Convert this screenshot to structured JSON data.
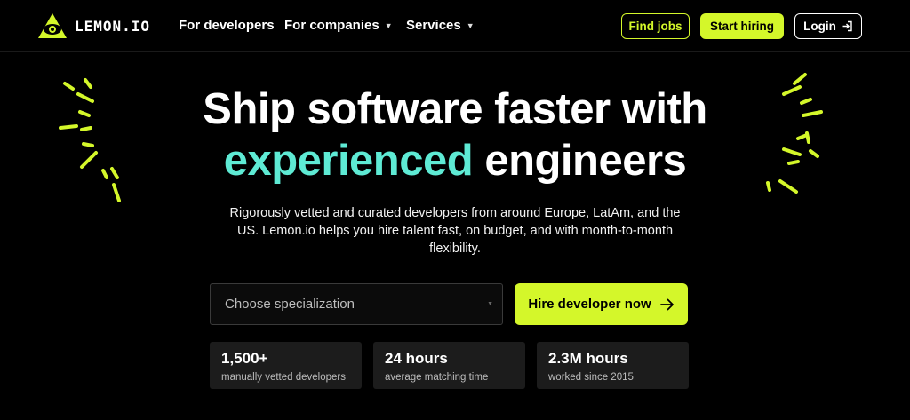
{
  "brand": {
    "name": "LEMON.IO"
  },
  "nav": {
    "links": [
      {
        "label": "For developers",
        "has_dropdown": false
      },
      {
        "label": "For companies",
        "has_dropdown": true
      },
      {
        "label": "Services",
        "has_dropdown": true
      }
    ],
    "find_jobs": "Find jobs",
    "start_hiring": "Start hiring",
    "login": "Login"
  },
  "hero": {
    "title_line1": "Ship software faster with",
    "title_accent": "experienced",
    "title_rest": "engineers",
    "subtitle": "Rigorously vetted and curated developers from around Europe, LatAm, and the US. Lemon.io helps you hire talent fast, on budget, and with month-to-month flexibility."
  },
  "form": {
    "select_placeholder": "Choose specialization",
    "cta": "Hire developer now"
  },
  "stats": [
    {
      "value": "1,500+",
      "label": "manually vetted developers"
    },
    {
      "value": "24 hours",
      "label": "average matching time"
    },
    {
      "value": "2.3M hours",
      "label": "worked since 2015"
    }
  ],
  "colors": {
    "background": "#000000",
    "lime": "#d4f72a",
    "teal_accent": "#5eead4",
    "stat_card": "#1c1c1c"
  },
  "icons": [
    "eye-triangle-logo-icon",
    "chevron-down-icon",
    "login-arrow-icon",
    "arrow-right-icon"
  ]
}
